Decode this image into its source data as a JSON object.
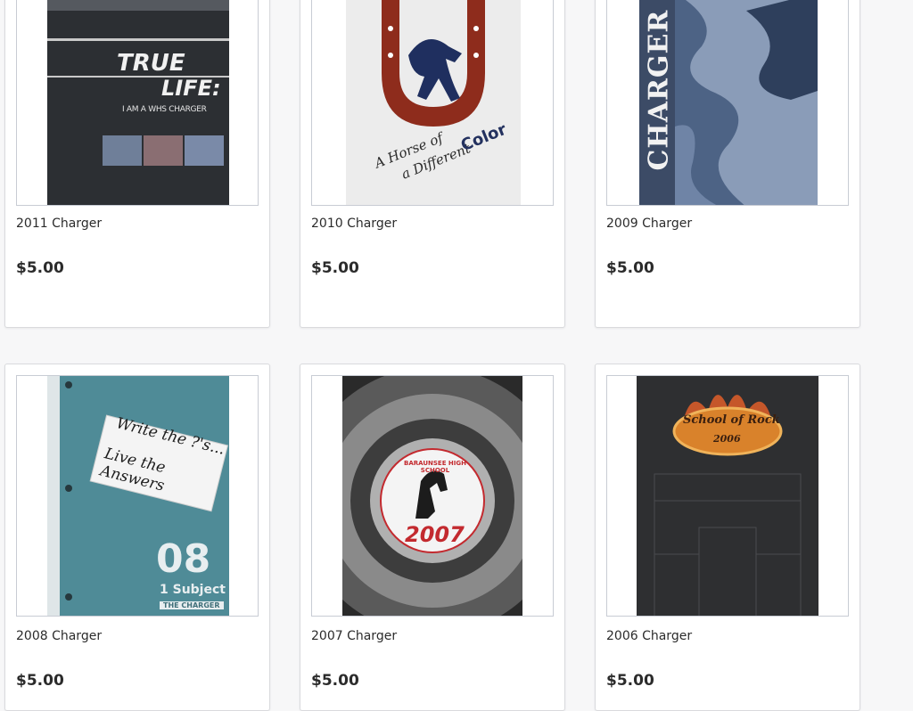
{
  "products": [
    {
      "title": "2011 Charger",
      "price": "$5.00",
      "cover": {
        "line1": "TRUE",
        "line2": "LIFE:",
        "line3": "I AM A WHS CHARGER",
        "color": "#2c2f33"
      }
    },
    {
      "title": "2010 Charger",
      "price": "$5.00",
      "cover": {
        "line1": "A Horse of",
        "line2": "a Different",
        "line3": "Color",
        "color": "#e9e9e9",
        "accent": "#8e2c1c"
      }
    },
    {
      "title": "2009 Charger",
      "price": "$5.00",
      "cover": {
        "line1": "CHARGER",
        "color": "#4d6385"
      }
    },
    {
      "title": "2008 Charger",
      "price": "$5.00",
      "cover": {
        "line1": "Write the ?'s...",
        "line2": "Live the Answers",
        "line3": "08",
        "line4": "1 Subject",
        "line5": "THE CHARGER",
        "color": "#4f8b97"
      }
    },
    {
      "title": "2007 Charger",
      "price": "$5.00",
      "cover": {
        "line1": "BARAUNSEE HIGH SCHOOL",
        "line2": "2007",
        "color": "#3a3a3a",
        "accent": "#c32a2f"
      }
    },
    {
      "title": "2006 Charger",
      "price": "$5.00",
      "cover": {
        "line1": "School of Rock",
        "line2": "2006",
        "color": "#2e2f31",
        "accent": "#d9822b"
      }
    }
  ]
}
